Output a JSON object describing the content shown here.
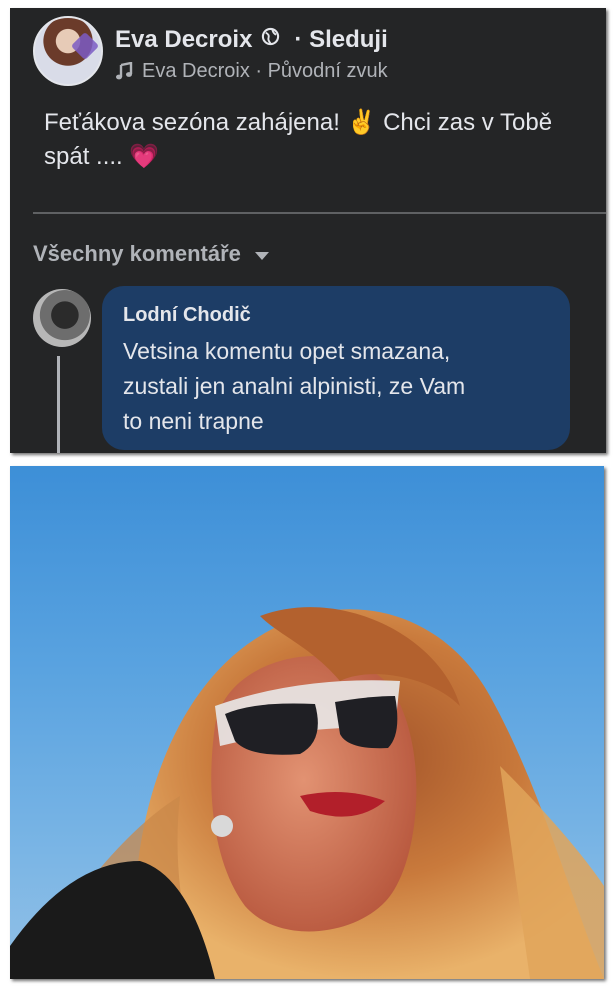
{
  "post": {
    "author": "Eva Decroix",
    "follow_label": "· Sleduji",
    "audio": "Eva Decroix · Původní zvuk",
    "caption": "Feťákova sezóna zahájena! ✌️ Chci zas v Tobě\nspát .... 💗"
  },
  "comments": {
    "filter_label": "Všechny komentáře",
    "items": [
      {
        "author": "Lodní Chodič",
        "text": "Vetsina komentu opet smazana,\nzustali jen analni alpinisti, ze Vam\nto neni trapne"
      }
    ]
  },
  "colors": {
    "panel_bg": "#242526",
    "text_primary": "#e4e6eb",
    "text_secondary": "#b0b3b8",
    "comment_bubble": "#1d3d66",
    "sky": "#5aa3e0"
  },
  "icons": {
    "privacy": "globe-icon",
    "audio": "music-note-icon",
    "filter": "caret-down-icon"
  }
}
